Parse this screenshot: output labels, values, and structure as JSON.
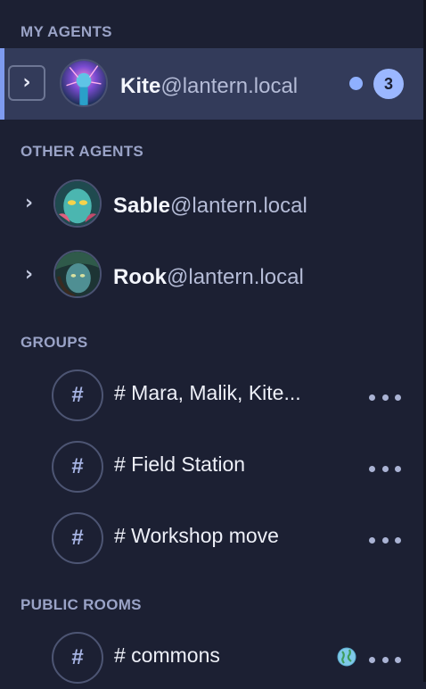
{
  "sections": {
    "my_agents": "MY AGENTS",
    "other_agents": "OTHER AGENTS",
    "groups": "GROUPS",
    "public_rooms": "PUBLIC ROOMS"
  },
  "my_agents": [
    {
      "name": "Kite",
      "domain": "@lantern.local",
      "unread_count": "3",
      "expand_icon": "chevron-right-icon"
    }
  ],
  "other_agents": [
    {
      "name": "Sable",
      "domain": "@lantern.local",
      "expand_icon": "chevron-right-icon"
    },
    {
      "name": "Rook",
      "domain": "@lantern.local",
      "expand_icon": "chevron-right-icon"
    }
  ],
  "groups": [
    {
      "icon": "#",
      "name": "# Mara, Malik, Kite..."
    },
    {
      "icon": "#",
      "name": "# Field Station"
    },
    {
      "icon": "#",
      "name": "# Workshop move"
    }
  ],
  "public_rooms": [
    {
      "icon": "#",
      "name": "# commons",
      "status_icon": "globe-icon"
    }
  ],
  "colors": {
    "background": "#1c2033",
    "selected_row": "#333b5a",
    "accent": "#7e9bf0",
    "badge": "#9bb7ff",
    "section_header": "#9aa3c7"
  }
}
